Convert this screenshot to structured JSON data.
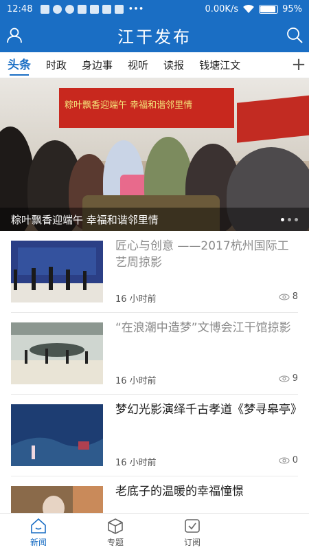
{
  "status_bar": {
    "time": "12:48",
    "notification_dots": "•••",
    "net_speed": "0.00K/s",
    "battery": "95%"
  },
  "header": {
    "title": "江干发布",
    "user_icon": "user-icon",
    "search_icon": "search-icon"
  },
  "tabs": [
    {
      "label": "头条",
      "active": true
    },
    {
      "label": "时政"
    },
    {
      "label": "身边事"
    },
    {
      "label": "视听"
    },
    {
      "label": "读报"
    },
    {
      "label": "钱塘江文"
    }
  ],
  "tab_add": "+",
  "banner": {
    "sign_text": "粽叶飘香迎端午 幸福和谐邻里情",
    "caption": "粽叶飘香迎端午 幸福和谐邻里情"
  },
  "news": [
    {
      "title": "匠心与创意 ——2017杭州国际工艺周掠影",
      "time": "16 小时前",
      "views": "8",
      "read": true
    },
    {
      "title": "“在浪潮中造梦”文博会江干馆掠影",
      "time": "16 小时前",
      "views": "9",
      "read": true
    },
    {
      "title": "梦幻光影演绎千古孝道《梦寻皋亭》",
      "time": "16 小时前",
      "views": "0",
      "read": false
    },
    {
      "title": "老底子的温暖的幸福憧憬",
      "time": "",
      "views": "",
      "read": false
    }
  ],
  "bottom_nav": [
    {
      "label": "新闻",
      "icon": "home-icon",
      "active": true
    },
    {
      "label": "专题",
      "icon": "cube-icon"
    },
    {
      "label": "订阅",
      "icon": "checkbox-icon"
    }
  ],
  "colors": {
    "accent": "#1a6ec4"
  }
}
